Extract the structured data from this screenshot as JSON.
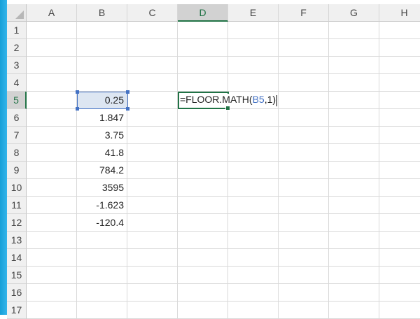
{
  "spreadsheet": {
    "columns": [
      "A",
      "B",
      "C",
      "D",
      "E",
      "F",
      "G",
      "H"
    ],
    "active_column": "D",
    "active_row": 5,
    "rows": [
      {
        "num": "1",
        "A": "",
        "B": "",
        "D": ""
      },
      {
        "num": "2",
        "A": "",
        "B": "",
        "D": ""
      },
      {
        "num": "3",
        "A": "",
        "B": "",
        "D": ""
      },
      {
        "num": "4",
        "A": "",
        "B": "",
        "D": ""
      },
      {
        "num": "5",
        "A": "",
        "B": "0.25",
        "D": ""
      },
      {
        "num": "6",
        "A": "",
        "B": "1.847",
        "D": ""
      },
      {
        "num": "7",
        "A": "",
        "B": "3.75",
        "D": ""
      },
      {
        "num": "8",
        "A": "",
        "B": "41.8",
        "D": ""
      },
      {
        "num": "9",
        "A": "",
        "B": "784.2",
        "D": ""
      },
      {
        "num": "10",
        "A": "",
        "B": "3595",
        "D": ""
      },
      {
        "num": "11",
        "A": "",
        "B": "-1.623",
        "D": ""
      },
      {
        "num": "12",
        "A": "",
        "B": "-120.4",
        "D": ""
      },
      {
        "num": "13",
        "A": "",
        "B": "",
        "D": ""
      },
      {
        "num": "14",
        "A": "",
        "B": "",
        "D": ""
      },
      {
        "num": "15",
        "A": "",
        "B": "",
        "D": ""
      },
      {
        "num": "16",
        "A": "",
        "B": "",
        "D": ""
      },
      {
        "num": "17",
        "A": "",
        "B": "",
        "D": ""
      }
    ],
    "editing_cell": {
      "prefix": "=FLOOR.MATH(",
      "ref": "B5",
      "suffix": ",1)"
    },
    "colors": {
      "excel_green": "#217346",
      "reference_blue": "#4472c4"
    }
  }
}
